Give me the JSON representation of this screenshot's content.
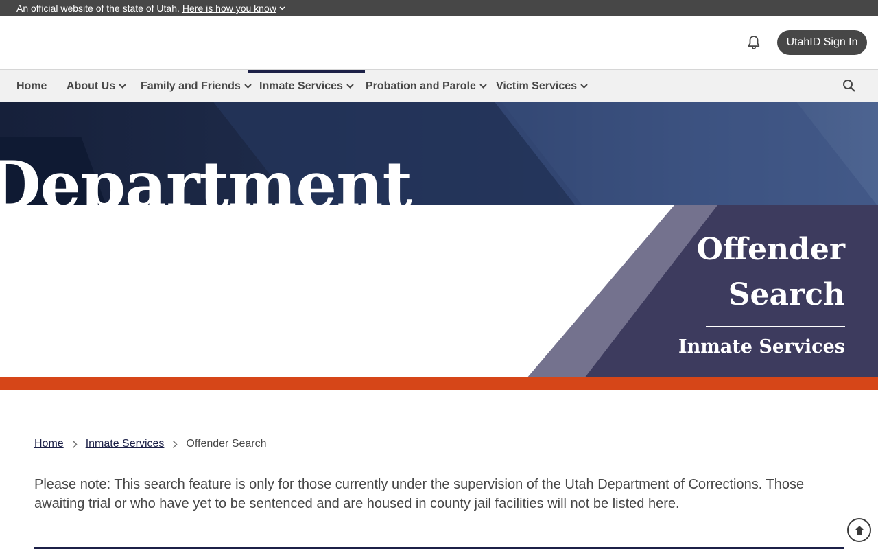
{
  "official_bar": {
    "text": "An official website of the state of Utah.",
    "link": "Here is how you know"
  },
  "header": {
    "bell_icon": "bell-icon",
    "signin_label": "UtahID Sign In"
  },
  "nav": {
    "items": [
      {
        "label": "Home",
        "has_dropdown": false
      },
      {
        "label": "About Us",
        "has_dropdown": true
      },
      {
        "label": "Family and Friends",
        "has_dropdown": true
      },
      {
        "label": "Inmate Services",
        "has_dropdown": true,
        "active": true
      },
      {
        "label": "Probation and Parole",
        "has_dropdown": true
      },
      {
        "label": "Victim Services",
        "has_dropdown": true
      }
    ],
    "search_icon": "search-icon"
  },
  "hero": {
    "background_word": "Department",
    "title_line1": "Offender",
    "title_line2": "Search",
    "subtitle": "Inmate Services",
    "colors": {
      "panel": "#3d3b5e",
      "panel_light": "#74728e",
      "accent_bar": "#d64618",
      "top_band": "#1e2b4a"
    }
  },
  "breadcrumb": {
    "items": [
      "Home",
      "Inmate Services"
    ],
    "current": "Offender Search"
  },
  "main": {
    "note": "Please note: This search feature is only for those currently under the supervision of the Utah Department of Corrections. Those awaiting trial or who have yet to be sentenced and are housed in county jail facilities will not be listed here."
  },
  "back_to_top_icon": "arrow-up-circle-icon"
}
